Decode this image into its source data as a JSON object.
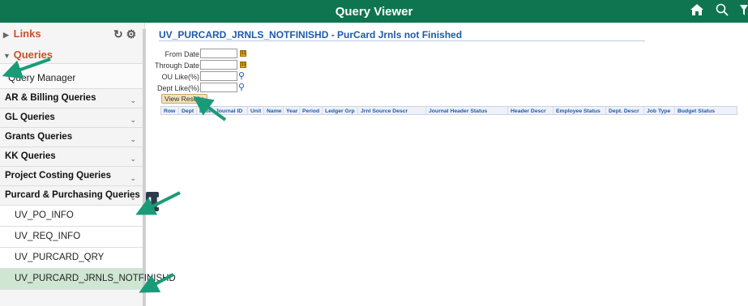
{
  "app": {
    "title": "Query Viewer"
  },
  "header_icons": [
    "home-icon",
    "search-icon",
    "filter-icon"
  ],
  "sidebar": {
    "tools": [
      "refresh-icon",
      "gear-icon"
    ],
    "links_label": "Links",
    "queries_label": "Queries",
    "query_manager": "Query Manager",
    "groups": [
      {
        "label": "AR & Billing Queries"
      },
      {
        "label": "GL Queries"
      },
      {
        "label": "Grants Queries"
      },
      {
        "label": "KK Queries"
      },
      {
        "label": "Project Costing Queries"
      },
      {
        "label": "Purcard & Purchasing Queries"
      }
    ],
    "subitems": [
      {
        "label": "UV_PO_INFO"
      },
      {
        "label": "UV_REQ_INFO"
      },
      {
        "label": "UV_PURCARD_QRY"
      },
      {
        "label": "UV_PURCARD_JRNLS_NOTFINISHD"
      }
    ]
  },
  "query": {
    "title": "UV_PURCARD_JRNLS_NOTFINISHD - PurCard Jrnls not Finished",
    "fields": [
      {
        "label": "From Date",
        "value": "",
        "type": "date"
      },
      {
        "label": "Through Date",
        "value": "",
        "type": "date"
      },
      {
        "label": "OU Like(%)",
        "value": "",
        "type": "lookup"
      },
      {
        "label": "Dept Like(%)",
        "value": "",
        "type": "lookup"
      }
    ],
    "view_button": "View Results",
    "columns": [
      "Row",
      "Dept",
      "Date",
      "Journal ID",
      "Unit",
      "Name",
      "Year",
      "Period",
      "Ledger Grp",
      "Jrnl Source Descr",
      "Journal Header Status",
      "Header Descr",
      "Employee Status",
      "Dept. Descr",
      "Job Type",
      "Budget Status"
    ]
  },
  "colors": {
    "header_bg": "#0e7550",
    "accent": "#c7512b",
    "link": "#1e5aa8",
    "arrow": "#1a9b78",
    "active_row": "#cfe6d3"
  }
}
